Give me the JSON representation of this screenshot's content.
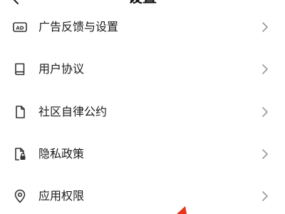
{
  "header": {
    "title": "设置",
    "back_icon": "back-arrow-icon"
  },
  "menu": {
    "items": [
      {
        "label": "广告反馈与设置",
        "icon": "ad-icon",
        "badge_text": "AD"
      },
      {
        "label": "用户协议",
        "icon": "book-icon"
      },
      {
        "label": "社区自律公约",
        "icon": "document-icon"
      },
      {
        "label": "隐私政策",
        "icon": "lock-document-icon"
      },
      {
        "label": "应用权限",
        "icon": "location-pin-icon"
      }
    ],
    "chevron_icon": "chevron-right-icon"
  },
  "colors": {
    "background": "#ffffff",
    "text": "#1a1a1a",
    "icon": "#333333",
    "chevron": "#999999",
    "annotation_red": "#e8341c"
  }
}
